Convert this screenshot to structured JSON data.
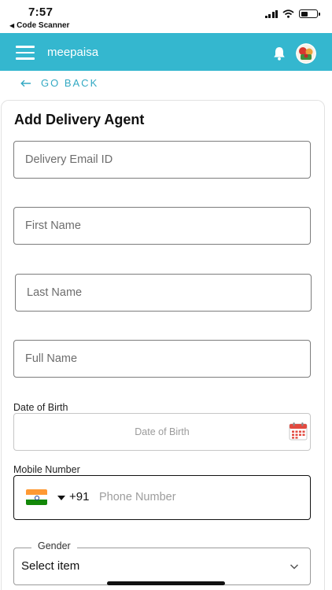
{
  "status_bar": {
    "time": "7:57",
    "back_app": "Code Scanner",
    "icons": [
      "signal-icon",
      "wifi-icon",
      "battery-icon"
    ]
  },
  "app_bar": {
    "title": "meepaisa",
    "background": "#34b7cf",
    "icons": [
      "menu-icon",
      "bell-icon",
      "avatar"
    ]
  },
  "nav": {
    "go_back": "GO BACK",
    "accent": "#33a9c3"
  },
  "form": {
    "title": "Add Delivery Agent",
    "fields": {
      "email": {
        "placeholder": "Delivery Email ID",
        "value": ""
      },
      "first_name": {
        "placeholder": "First Name",
        "value": ""
      },
      "last_name": {
        "placeholder": "Last Name",
        "value": ""
      },
      "full_name": {
        "placeholder": "Full Name",
        "value": ""
      }
    },
    "dob": {
      "label": "Date of Birth",
      "placeholder": "Date of Birth",
      "icon": "calendar-icon"
    },
    "mobile": {
      "label": "Mobile Number",
      "country_flag": "india-flag-icon",
      "dial_code": "+91",
      "placeholder": "Phone Number"
    },
    "gender": {
      "label": "Gender",
      "selected": "Select item",
      "icon": "chevron-down-icon"
    }
  }
}
